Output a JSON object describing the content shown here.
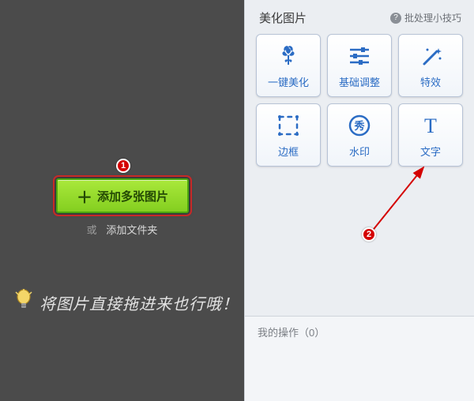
{
  "annotations": {
    "badge1": "1",
    "badge2": "2"
  },
  "left": {
    "add_button_label": "添加多张图片",
    "or_label": "或",
    "add_folder_label": "添加文件夹",
    "drag_tip": "将图片直接拖进来也行哦！"
  },
  "right": {
    "title": "美化图片",
    "tips_label": "批处理小技巧",
    "my_ops_label": "我的操作（0）"
  },
  "tools": [
    {
      "id": "one-click-beautify",
      "label": "一键美化",
      "icon": "flower-icon"
    },
    {
      "id": "basic-adjust",
      "label": "基础调整",
      "icon": "sliders-icon"
    },
    {
      "id": "effects",
      "label": "特效",
      "icon": "wand-icon"
    },
    {
      "id": "frame",
      "label": "边框",
      "icon": "frame-icon"
    },
    {
      "id": "watermark",
      "label": "水印",
      "icon": "stamp-icon"
    },
    {
      "id": "text",
      "label": "文字",
      "icon": "text-icon"
    }
  ],
  "colors": {
    "accent_blue": "#2b6cc4",
    "green": "#84cf20",
    "badge_red": "#d40000"
  }
}
